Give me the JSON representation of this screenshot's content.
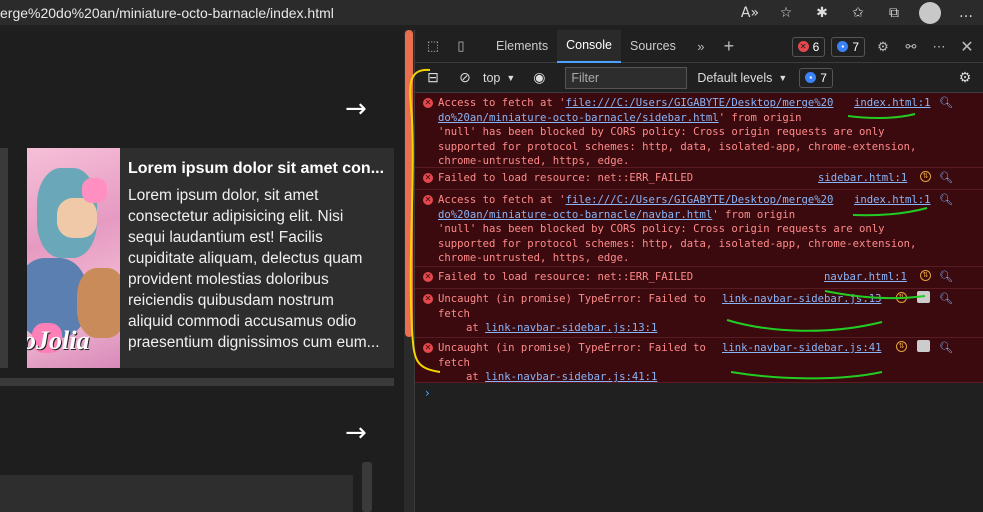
{
  "browser": {
    "url": "erge%20do%20an/miniature-octo-barnacle/index.html"
  },
  "page": {
    "card": {
      "title": "Lorem ipsum dolor sit amet con...",
      "lines": [
        "Lorem ipsum dolor, sit amet",
        "consectetur adipisicing elit. Nisi",
        "sequi laudantium est! Facilis",
        "cupiditate aliquam, delectus quam",
        "provident molestias doloribus",
        "reiciendis quibusdam nostrum",
        "aliquid commodi accusamus odio",
        "praesentium dignissimos cum eum..."
      ],
      "image_text": "oJolia"
    },
    "arrow1": "→",
    "arrow2": "→"
  },
  "devtools": {
    "tabs": [
      "Elements",
      "Console",
      "Sources"
    ],
    "active_tab": "Console",
    "error_count": "6",
    "info_count": "7",
    "toolbar": {
      "context": "top",
      "filter_placeholder": "Filter",
      "levels": "Default levels",
      "issues_count": "7"
    },
    "messages": [
      {
        "lines": [
          "Access to fetch at '",
          "file:///C:/Users/GIGABYTE/Desktop/merge%20",
          "do%20an/miniature-octo-barnacle/sidebar.html",
          "' from origin",
          "'null' has been blocked by CORS policy: Cross origin requests are only",
          "supported for protocol schemes: http, data, isolated-app, chrome-extension,",
          "chrome-untrusted, https, edge."
        ],
        "source": "index.html:1"
      },
      {
        "text": "Failed to load resource: net::ERR_FAILED",
        "source": "sidebar.html:1"
      },
      {
        "lines": [
          "Access to fetch at '",
          "file:///C:/Users/GIGABYTE/Desktop/merge%20",
          "do%20an/miniature-octo-barnacle/navbar.html",
          "' from origin",
          "'null' has been blocked by CORS policy: Cross origin requests are only",
          "supported for protocol schemes: http, data, isolated-app, chrome-extension,",
          "chrome-untrusted, https, edge."
        ],
        "source": "index.html:1"
      },
      {
        "text": "Failed to load resource: net::ERR_FAILED",
        "source": "navbar.html:1"
      },
      {
        "text1": "Uncaught (in promise) TypeError: Failed to",
        "text2": "fetch",
        "at": "at ",
        "at_link": "link-navbar-sidebar.js:13:1",
        "source": "link-navbar-sidebar.js:13"
      },
      {
        "text1": "Uncaught (in promise) TypeError: Failed to",
        "text2": "fetch",
        "at": "at ",
        "at_link": "link-navbar-sidebar.js:41:1",
        "source": "link-navbar-sidebar.js:41"
      }
    ],
    "prompt": "›"
  }
}
